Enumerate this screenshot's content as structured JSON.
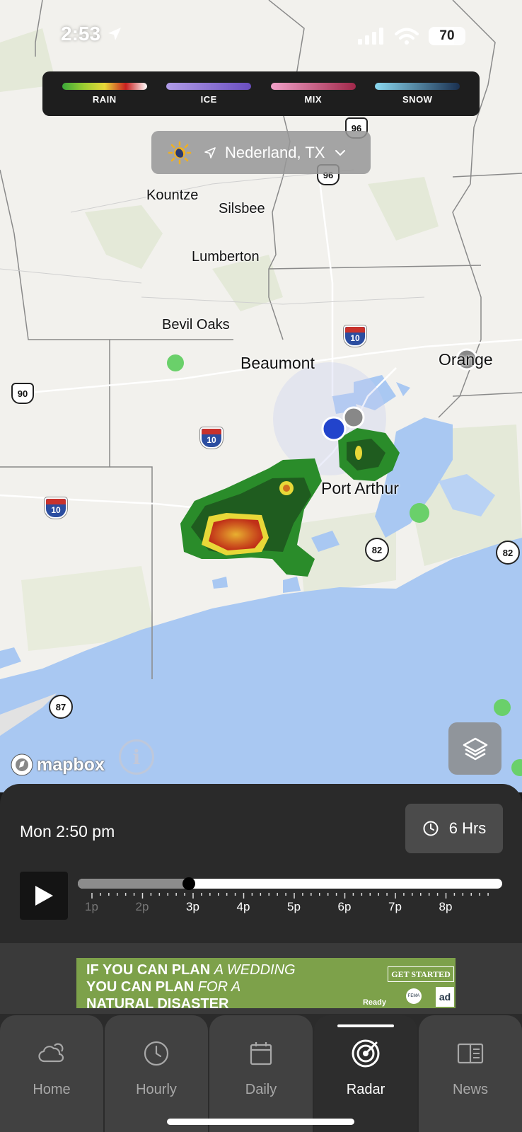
{
  "status_bar": {
    "time": "2:53",
    "battery": "70"
  },
  "legend": [
    {
      "label": "RAIN",
      "gradient": [
        "#3aa83a",
        "#9acd32",
        "#e8d838",
        "#c82020",
        "#ffffff"
      ]
    },
    {
      "label": "ICE",
      "gradient": [
        "#b09ce8",
        "#6a4ec0"
      ]
    },
    {
      "label": "MIX",
      "gradient": [
        "#f0a0c8",
        "#a0284a"
      ]
    },
    {
      "label": "SNOW",
      "gradient": [
        "#8ad8f0",
        "#1a3050"
      ]
    }
  ],
  "location": {
    "name": "Nederland, TX",
    "icon": "partly-sunny-icon"
  },
  "map": {
    "cities": [
      "Kountze",
      "Silsbee",
      "Lumberton",
      "Bevil Oaks",
      "Beaumont",
      "Orange",
      "Port Arthur"
    ],
    "shields": {
      "us96_top": "96",
      "us96_low": "96",
      "i10_east": "10",
      "us90": "90",
      "i10_mid": "10",
      "i10_west": "10",
      "sh82_mid": "82",
      "sh82_right": "82",
      "sh87": "87"
    },
    "attribution": "mapbox"
  },
  "timeline": {
    "current_time": "Mon 2:50 pm",
    "range_label": "6 Hrs",
    "progress": 0.26,
    "hours": [
      "1p",
      "2p",
      "3p",
      "4p",
      "5p",
      "6p",
      "7p",
      "8p"
    ]
  },
  "ad": {
    "line1_bold": "IF YOU CAN PLAN",
    "line1_italic": "A WEDDING",
    "line2_bold": "YOU CAN PLAN",
    "line2_italic": "FOR A",
    "line3": "NATURAL DISASTER",
    "cta": "GET STARTED",
    "ready": "Ready",
    "fema": "FEMA",
    "adc": "ad"
  },
  "tabs": [
    {
      "label": "Home",
      "icon": "cloud-icon"
    },
    {
      "label": "Hourly",
      "icon": "clock-icon"
    },
    {
      "label": "Daily",
      "icon": "calendar-icon"
    },
    {
      "label": "Radar",
      "icon": "radar-icon",
      "active": true
    },
    {
      "label": "News",
      "icon": "newspaper-icon"
    }
  ]
}
